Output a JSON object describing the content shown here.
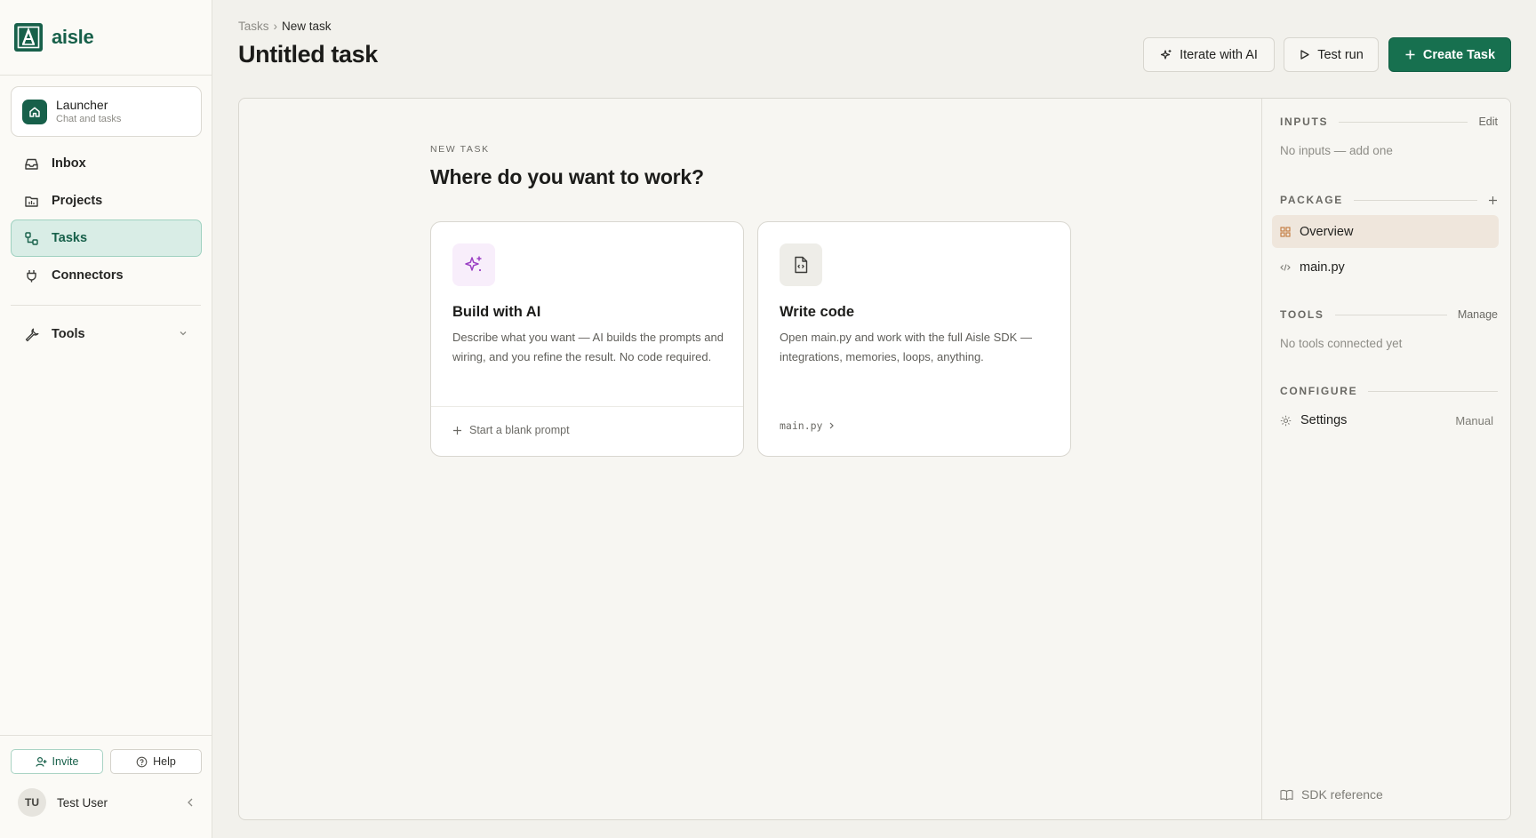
{
  "brand": {
    "name": "aisle",
    "accent": "#17604a"
  },
  "sidebar": {
    "launcher": {
      "title": "Launcher",
      "subtitle": "Chat and tasks",
      "icon": "home-icon"
    },
    "items": [
      {
        "label": "Inbox",
        "icon": "inbox-icon"
      },
      {
        "label": "Projects",
        "icon": "folder-icon"
      },
      {
        "label": "Tasks",
        "icon": "tasks-icon",
        "active": true
      },
      {
        "label": "Connectors",
        "icon": "plug-icon"
      },
      {
        "label": "Tools",
        "icon": "wrench-icon"
      }
    ],
    "invite_label": "Invite",
    "help_label": "Help",
    "user": {
      "initials": "TU",
      "name": "Test User"
    }
  },
  "header": {
    "breadcrumb": [
      "Tasks",
      "›",
      "New task"
    ],
    "title": "Untitled task",
    "iterate_label": "Iterate with AI",
    "test_run_label": "Test run",
    "create_label": "Create Task",
    "create_color": "#17704f"
  },
  "main": {
    "kicker": "NEW TASK",
    "question": "Where do you want to work?",
    "cards": [
      {
        "title": "Build with AI",
        "description": "Describe what you want — AI builds the prompts and wiring, and you refine the result. No code required.",
        "footer": "Start a blank prompt",
        "icon": "sparkles-icon",
        "icon_color": "#9b3fc4"
      },
      {
        "title": "Write code",
        "description": "Open main.py and work with the full Aisle SDK — integrations, memories, loops, anything.",
        "footer": "main.py",
        "icon": "code-file-icon"
      }
    ]
  },
  "rail": {
    "inputs": {
      "label": "INPUTS",
      "action": "Edit",
      "empty": "No inputs — add one"
    },
    "package": {
      "label": "PACKAGE",
      "items": [
        "Overview",
        "main.py"
      ]
    },
    "tools": {
      "label": "TOOLS",
      "action": "Manage",
      "empty": "No tools connected yet"
    },
    "configure": {
      "label": "CONFIGURE",
      "setting_label": "Settings",
      "setting_value": "Manual"
    },
    "sdk_label": "SDK reference"
  }
}
